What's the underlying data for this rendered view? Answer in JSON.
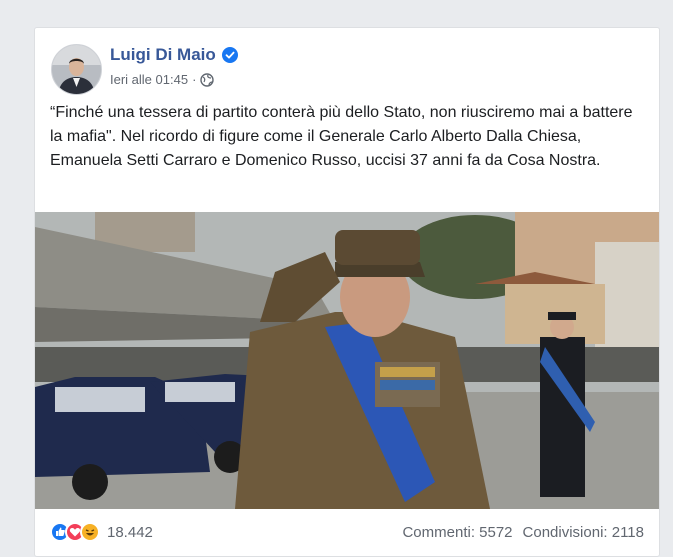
{
  "post": {
    "author": "Luigi Di Maio",
    "timestamp": "Ieri alle 01:45",
    "separator": "·",
    "audience_icon": "globe-icon",
    "verified_icon": "verified-badge-icon",
    "text": "“Finché una tessera di partito conterà più dello Stato, non riusciremo mai a battere la mafia\". Nel ricordo di figure come il Generale Carlo Alberto Dalla Chiesa, Emanuela Setti Carraro e Domenico Russo, uccisi 37 anni fa da Cosa Nostra."
  },
  "footer": {
    "reaction_icons": [
      "like-icon",
      "love-icon",
      "haha-icon"
    ],
    "reaction_count": "18.442",
    "comments": "Commenti: 5572",
    "shares": "Condivisioni: 2118"
  },
  "colors": {
    "author_blue": "#385898",
    "like_blue": "#1877f2",
    "love_red": "#f33e58",
    "haha_yellow": "#f7b125"
  }
}
